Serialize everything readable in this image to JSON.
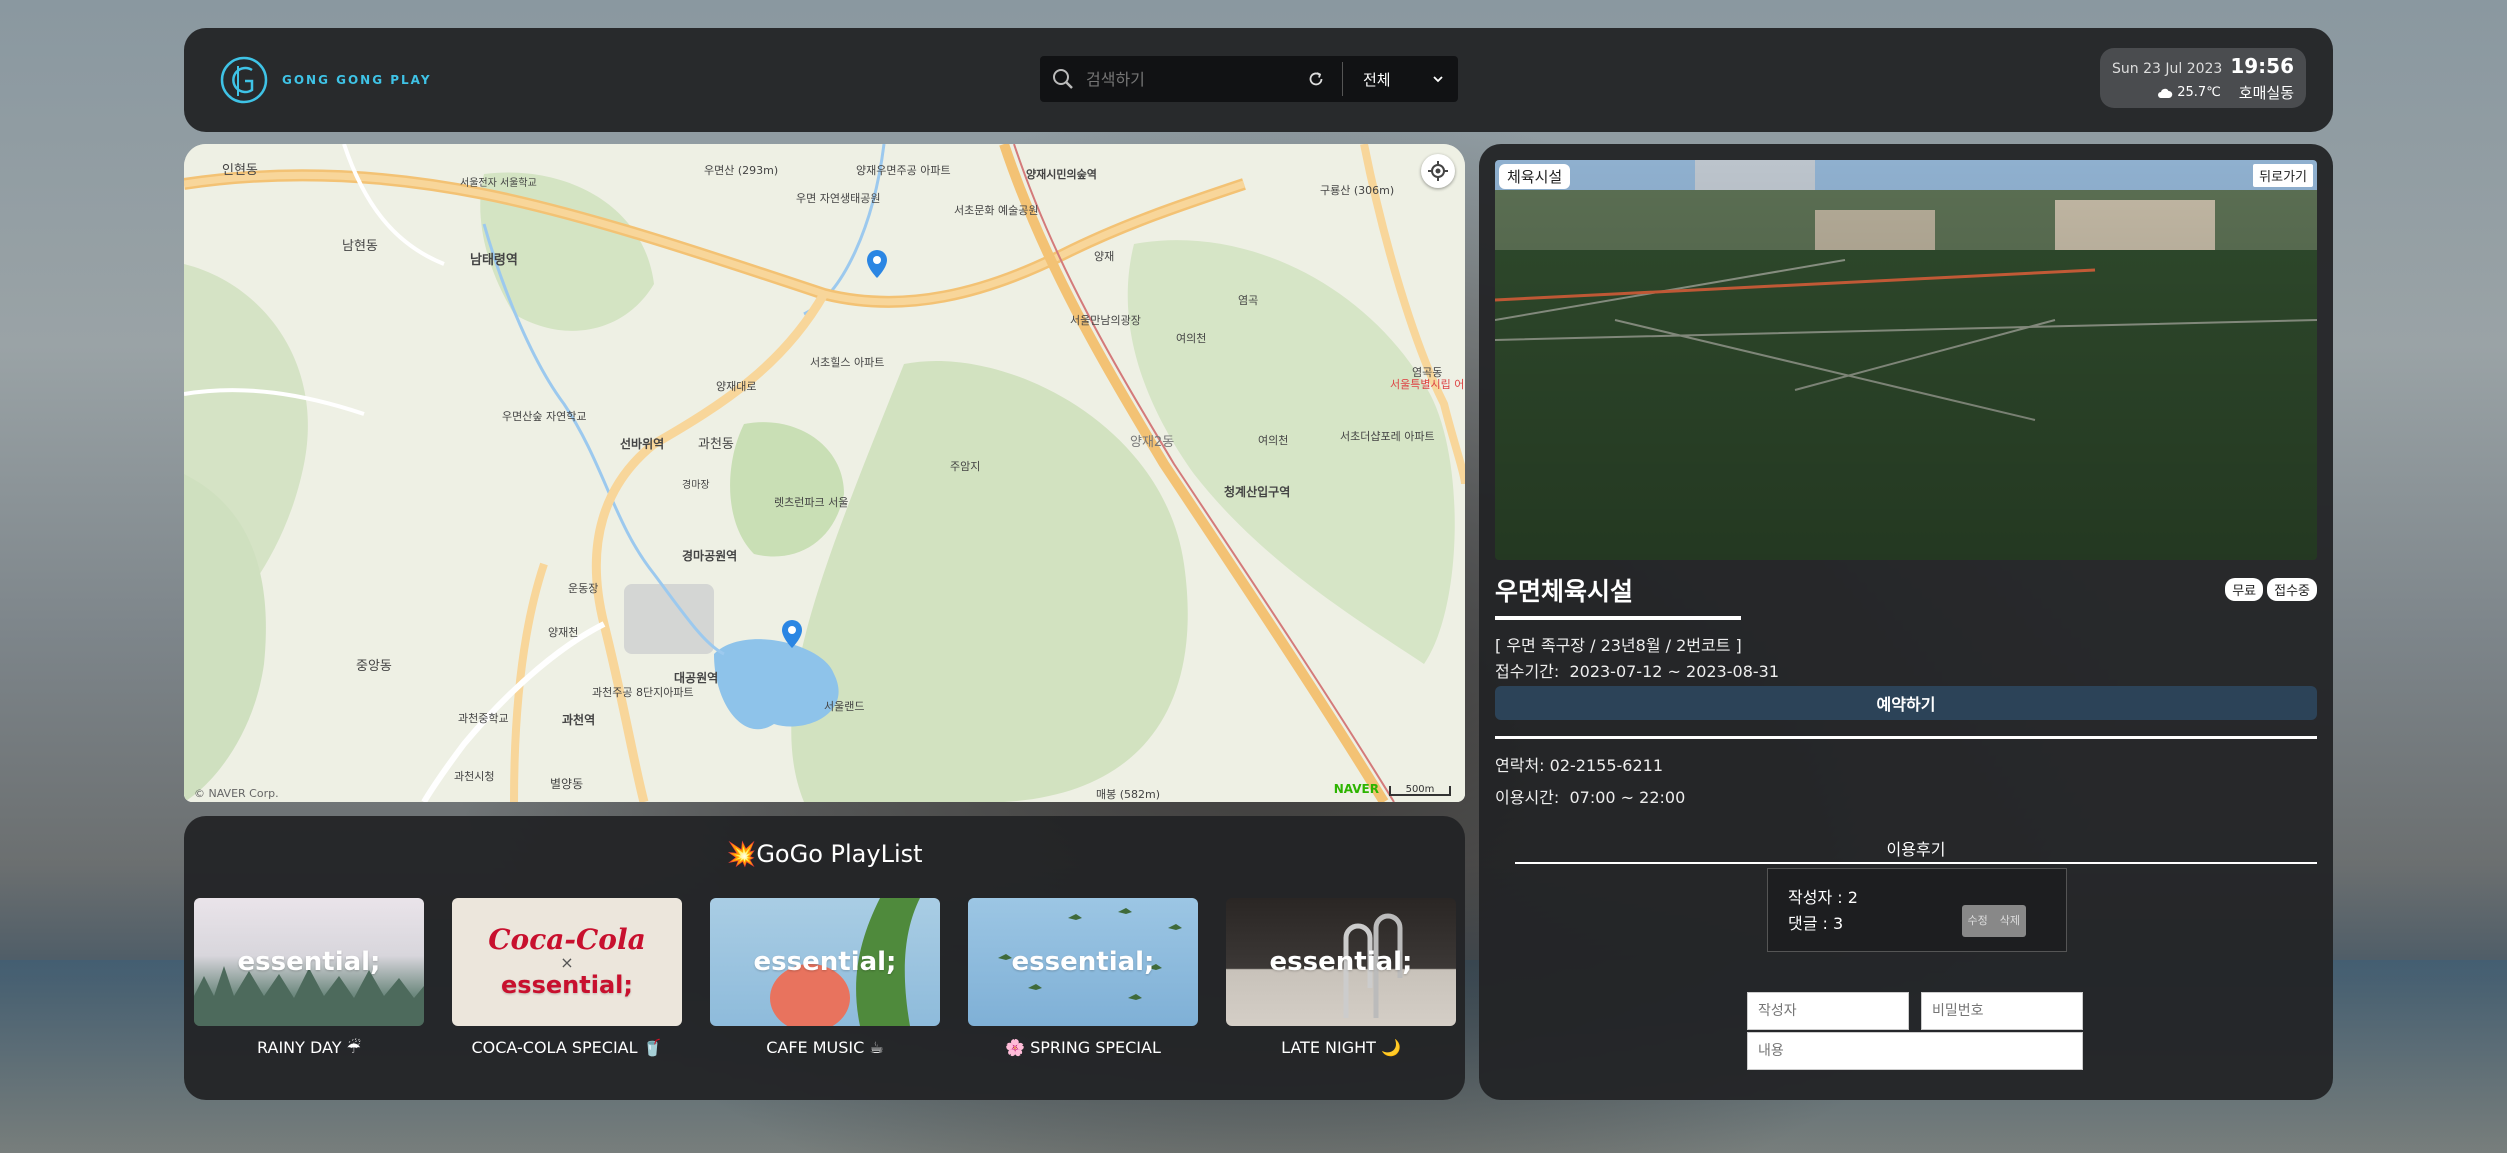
{
  "header": {
    "logo_text": "GONG GONG PLAY",
    "search_placeholder": "검색하기",
    "category_select": "전체",
    "date": "Sun 23 Jul 2023",
    "time": "19:56",
    "temperature": "25.7℃",
    "weather_icon": "cloud-icon",
    "location": "호매실동"
  },
  "map": {
    "labels": [
      "인현동",
      "남현동",
      "남태령역",
      "우면산 (293m)",
      "양재우면주공 아파트",
      "양재시민의숲역",
      "우면 자연생태공원",
      "서초문화 예술공원",
      "구룡산 (306m)",
      "양재",
      "염곡",
      "서울만남의광장",
      "여의천",
      "서초힐스 아파트",
      "양재대로",
      "우면산숲 자연학교",
      "선바위역",
      "과천동",
      "주암지",
      "양재2동",
      "여의천",
      "청계산입구역",
      "서초더샵포레 아파트",
      "서울특별시립 어린이병원",
      "렛츠런파크 서울",
      "경마공원역",
      "운동장",
      "양재천",
      "중앙동",
      "대공원역",
      "과천중학교",
      "과천역",
      "서울랜드",
      "과천시청",
      "별양동",
      "매봉 (582m)",
      "염곡동",
      "과천주공 8단지아파트",
      "경마장",
      "서울전자 서울학교"
    ],
    "copyright": "© NAVER Corp.",
    "brand": "NAVER",
    "scale": "500m"
  },
  "playlist": {
    "title": "💥GoGo PlayList",
    "items": [
      {
        "label": "RAINY DAY ☔",
        "cover_text": "essential;",
        "theme": "#d6d4dc"
      },
      {
        "label": "COCA-COLA SPECIAL 🥤",
        "cover_text": "essential;",
        "theme": "#e8e2d8"
      },
      {
        "label": "CAFE MUSIC ☕",
        "cover_text": "essential;",
        "theme": "#9cc3de"
      },
      {
        "label": "🌸 SPRING SPECIAL",
        "cover_text": "essential;",
        "theme": "#8db5d8"
      },
      {
        "label": "LATE NIGHT 🌙",
        "cover_text": "essential;",
        "theme": "#3a3634"
      }
    ],
    "coke_text": "Coca-Cola",
    "coke_x": "×"
  },
  "detail": {
    "category_tag": "체육시설",
    "back_label": "뒤로가기",
    "title": "우면체육시설",
    "badges": [
      "무료",
      "접수중"
    ],
    "description": "[ 우면 족구장 / 23년8월 / 2번코트 ]",
    "period_label": "접수기간:",
    "period": "2023-07-12 ~ 2023-08-31",
    "reserve_label": "예약하기",
    "contact_label": "연락처:",
    "contact": "02-2155-6211",
    "hours_label": "이용시간:",
    "hours": "07:00 ~ 22:00",
    "review_title": "이용후기",
    "review": {
      "author_line": "작성자 : 2",
      "comment_line": "댓글 : 3",
      "edit_label": "수정",
      "delete_label": "삭제"
    },
    "form": {
      "author_placeholder": "작성자",
      "password_placeholder": "비밀번호",
      "content_placeholder": "내용"
    }
  },
  "colors": {
    "panel": "#232426",
    "accent": "#3fc3e6",
    "reserve_button": "#2c4358",
    "naver_green": "#2db400"
  }
}
